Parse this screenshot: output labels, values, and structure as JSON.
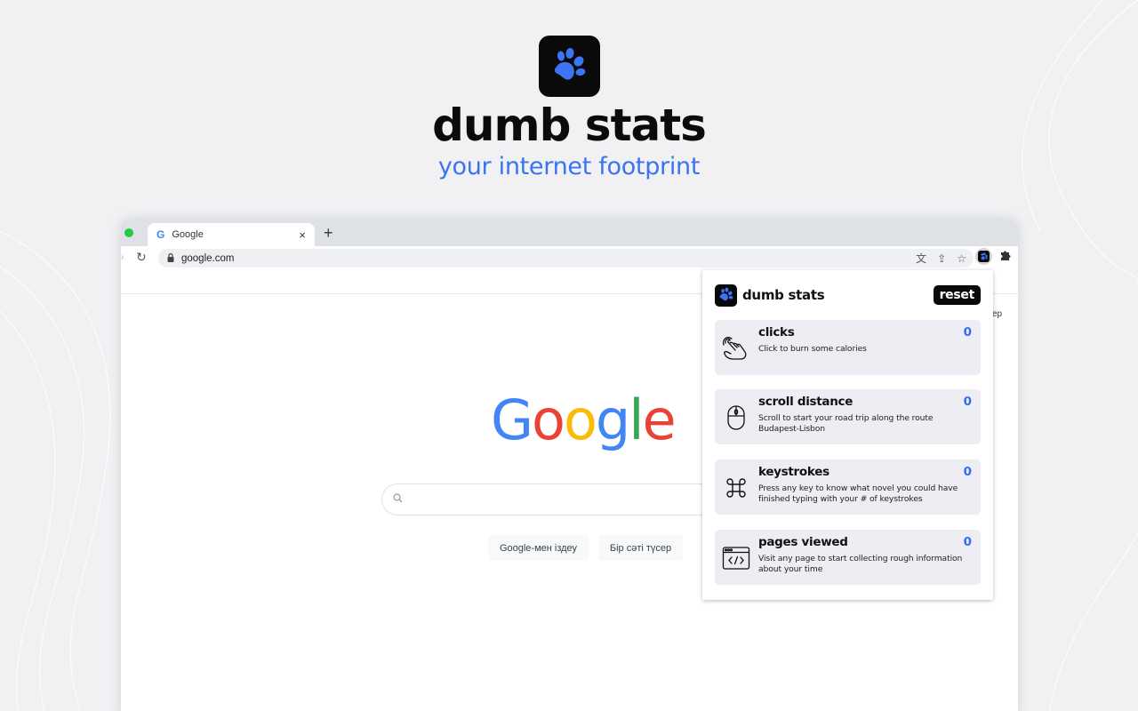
{
  "hero": {
    "logo_icon": "paw-icon",
    "title": "dumb stats",
    "subtitle": "your internet footprint"
  },
  "browser": {
    "tab": {
      "favicon": "google-g-icon",
      "favicon_text": "G",
      "title": "Google",
      "close_label": "×"
    },
    "new_tab_label": "+",
    "toolbar": {
      "forward_icon": "›",
      "reload_icon": "↻",
      "lock_icon": "🔒",
      "url": "google.com",
      "translate_icon": "文",
      "share_icon": "⇪",
      "bookmark_icon": "☆",
      "extensions_icon": "✱"
    },
    "page": {
      "logo_letters": [
        {
          "ch": "G",
          "color": "#4285f4"
        },
        {
          "ch": "o",
          "color": "#ea4335"
        },
        {
          "ch": "o",
          "color": "#fbbc05"
        },
        {
          "ch": "g",
          "color": "#4285f4"
        },
        {
          "ch": "l",
          "color": "#34a853"
        },
        {
          "ch": "e",
          "color": "#ea4335"
        }
      ],
      "search_value": "",
      "search_icon": "⚲",
      "search_button": "Google-мен іздеу",
      "lucky_button": "Бір сәті түсер",
      "images_link_partial": "ep"
    }
  },
  "popup": {
    "title": "dumb stats",
    "reset_label": "reset",
    "accent_color": "#2f6df6",
    "stats": [
      {
        "icon": "hand-pointer-icon",
        "name": "clicks",
        "value": "0",
        "description": "Click to burn some calories"
      },
      {
        "icon": "mouse-icon",
        "name": "scroll distance",
        "value": "0",
        "description": "Scroll to start your road trip along the route Budapest-Lisbon"
      },
      {
        "icon": "command-key-icon",
        "name": "keystrokes",
        "value": "0",
        "description": "Press any key to know what novel you could have finished typing with your # of keystrokes"
      },
      {
        "icon": "browser-code-icon",
        "name": "pages viewed",
        "value": "0",
        "description": "Visit any page to start collecting rough information about your time"
      }
    ]
  }
}
